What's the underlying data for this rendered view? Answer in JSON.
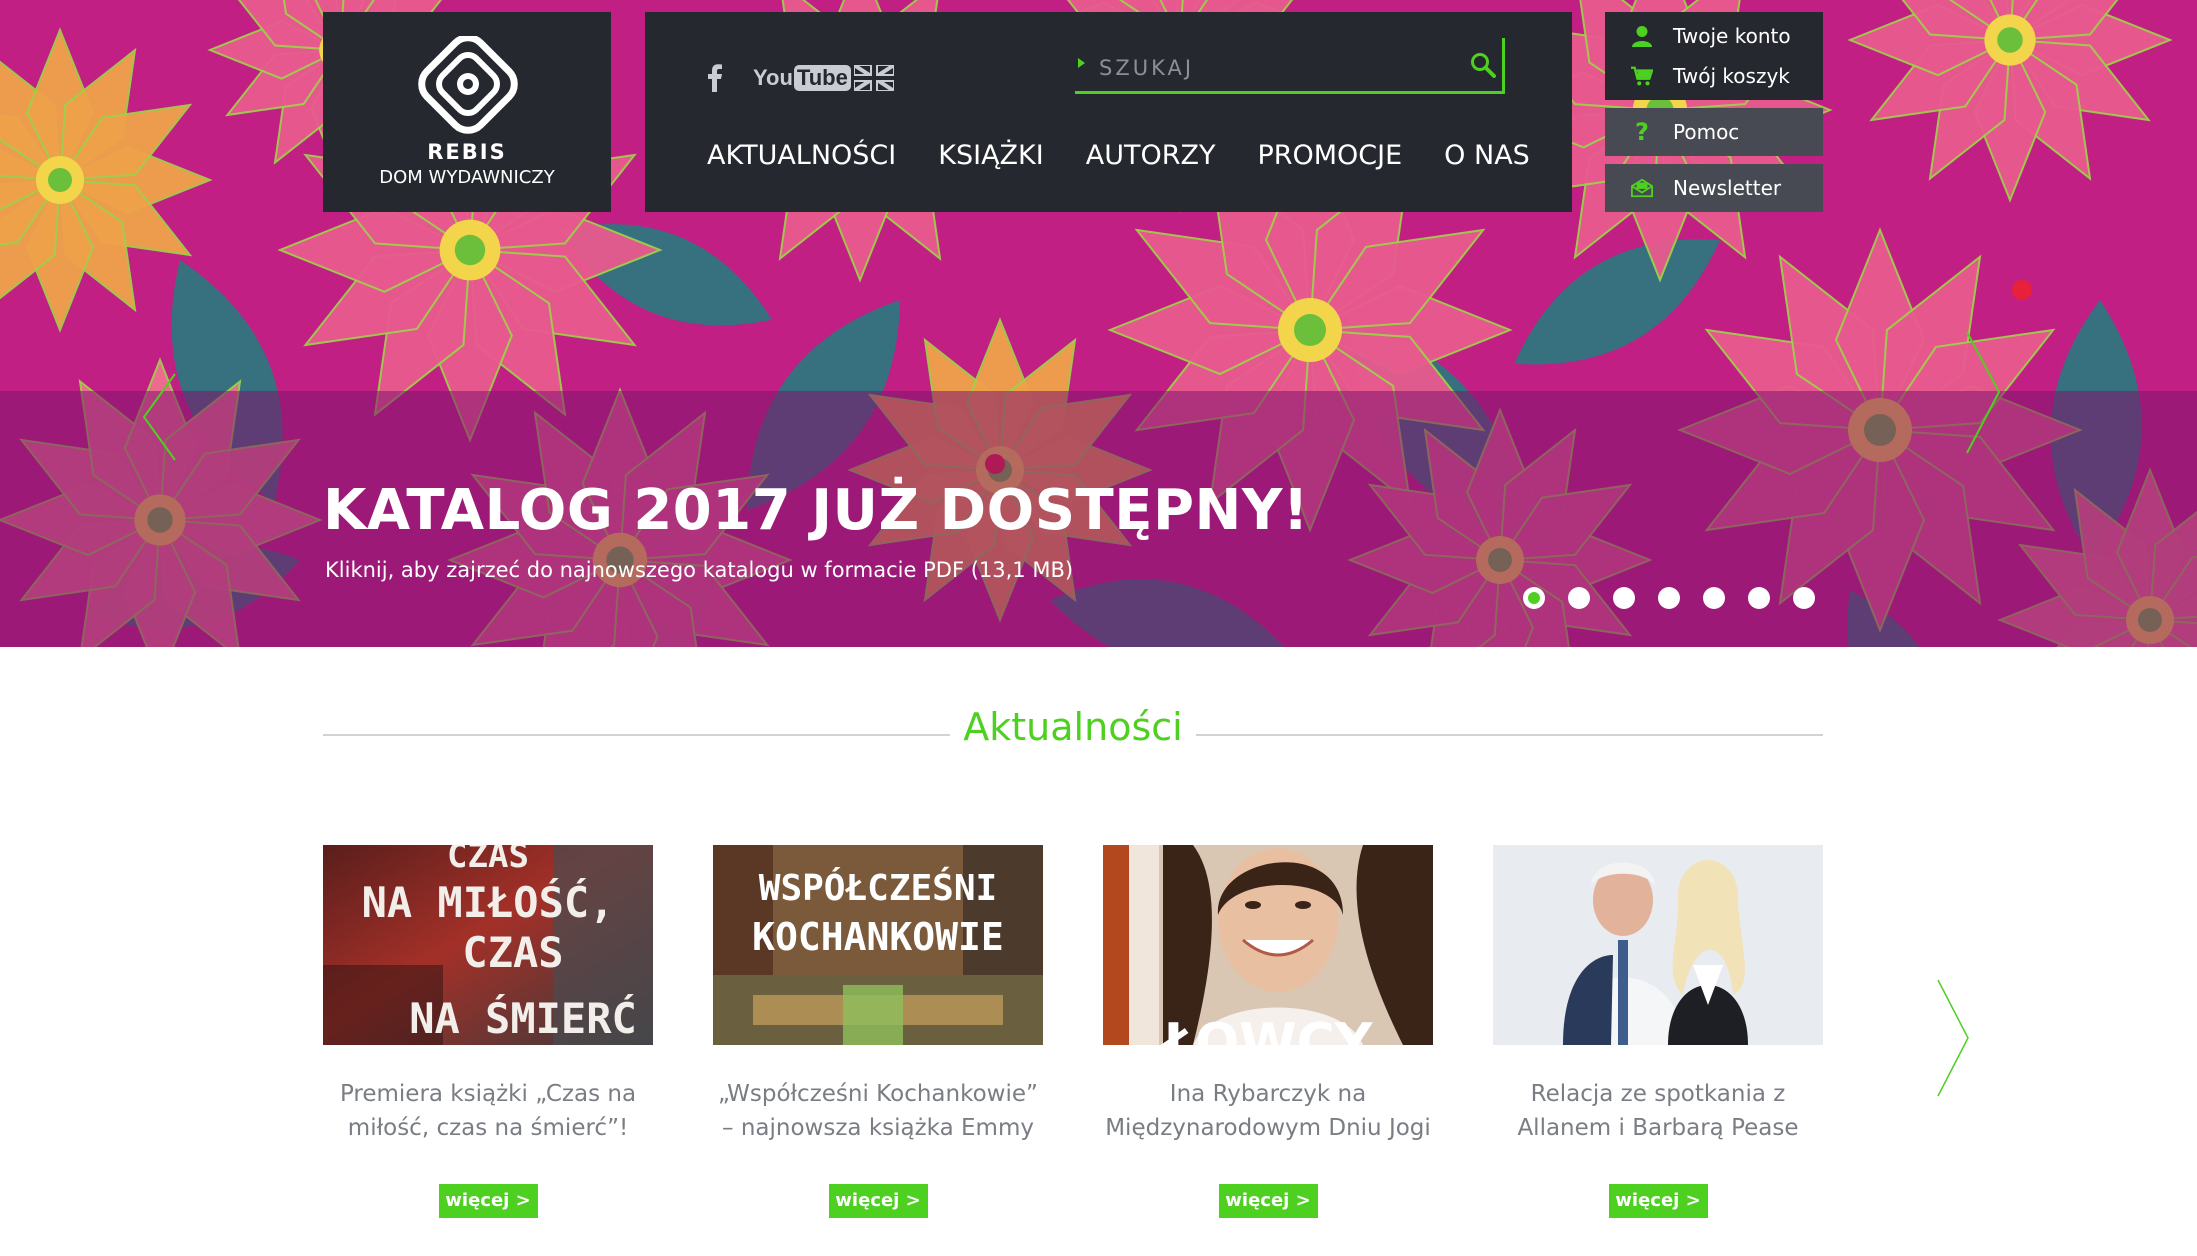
{
  "brand": {
    "logo_word": "REBIS",
    "subtitle": "DOM WYDAWNICZY"
  },
  "social": {
    "facebook_icon": "facebook-icon",
    "youtube_you": "You",
    "youtube_tube": "Tube",
    "language_icon": "uk-flag-icon"
  },
  "search": {
    "placeholder": "SZUKAJ"
  },
  "menu": [
    {
      "label": "AKTUALNOŚCI"
    },
    {
      "label": "KSIĄŻKI"
    },
    {
      "label": "AUTORZY"
    },
    {
      "label": "PROMOCJE"
    },
    {
      "label": "O NAS"
    }
  ],
  "account": {
    "account_label": "Twoje konto",
    "cart_label": "Twój koszyk",
    "help_label": "Pomoc",
    "help_icon": "?",
    "newsletter_label": "Newsletter"
  },
  "hero": {
    "title": "KATALOG 2017 JUŻ DOSTĘPNY!",
    "subtitle": "Kliknij, aby zajrzeć do najnowszego katalogu w formacie PDF (13,1 MB)",
    "slide_count": 7,
    "active_slide": 1
  },
  "news": {
    "heading": "Aktualności",
    "items": [
      {
        "title": "Premiera książki „Czas na miłość, czas na śmierć”!",
        "more": "więcej >",
        "image_text": [
          "CZAS",
          "NA MIŁOŚĆ,",
          "CZAS",
          "NA ŚMIERĆ"
        ]
      },
      {
        "title": "„Współcześni Kochankowie” – najnowsza książka Emmy",
        "more": "więcej >",
        "image_text": [
          "WSPÓŁCZEŚNI",
          "KOCHANKOWIE"
        ]
      },
      {
        "title": "Ina Rybarczyk na Międzynarodowym Dniu Jogi w",
        "more": "więcej >",
        "image_text": [
          "ŁOWCY"
        ]
      },
      {
        "title": "Relacja ze spotkania z Allanem i Barbarą Pease",
        "more": "więcej >",
        "image_text": []
      }
    ]
  },
  "colors": {
    "accent": "#4ed021",
    "dark": "#25282f",
    "gray_button": "#474a52",
    "hero_pink": "#c9218a",
    "text_gray": "#7a7d84"
  }
}
